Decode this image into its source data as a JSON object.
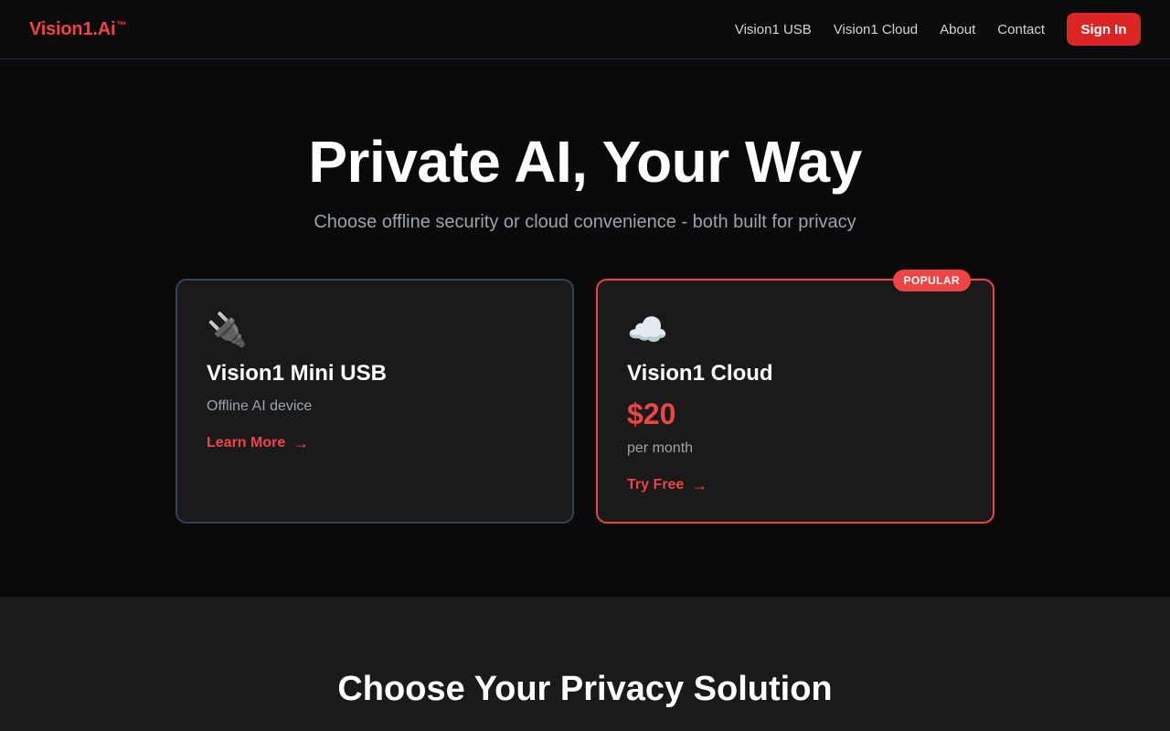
{
  "nav": {
    "logo": "Vision1.Ai",
    "logo_mark": "™",
    "links": [
      "Vision1 USB",
      "Vision1 Cloud",
      "About",
      "Contact"
    ],
    "signin_label": "Sign In"
  },
  "hero": {
    "title": "Private AI, Your Way",
    "subtitle": "Choose offline security or cloud convenience - both built for privacy"
  },
  "cards": [
    {
      "icon": "🔌",
      "icon_name": "plug-icon",
      "title": "Vision1 Mini USB",
      "description": "Offline AI device",
      "link_label": "Learn More",
      "arrow": "→"
    },
    {
      "badge": "POPULAR",
      "icon": "☁️",
      "icon_name": "cloud-icon",
      "title": "Vision1 Cloud",
      "price": "$20",
      "period": "per month",
      "link_label": "Try Free",
      "arrow": "→"
    }
  ],
  "section2": {
    "title": "Choose Your Privacy Solution"
  },
  "colors": {
    "accent": "#ef4444",
    "signin_bg": "#dc2626",
    "background": "#0a0a0a",
    "card_bg": "#1a1a1a"
  }
}
